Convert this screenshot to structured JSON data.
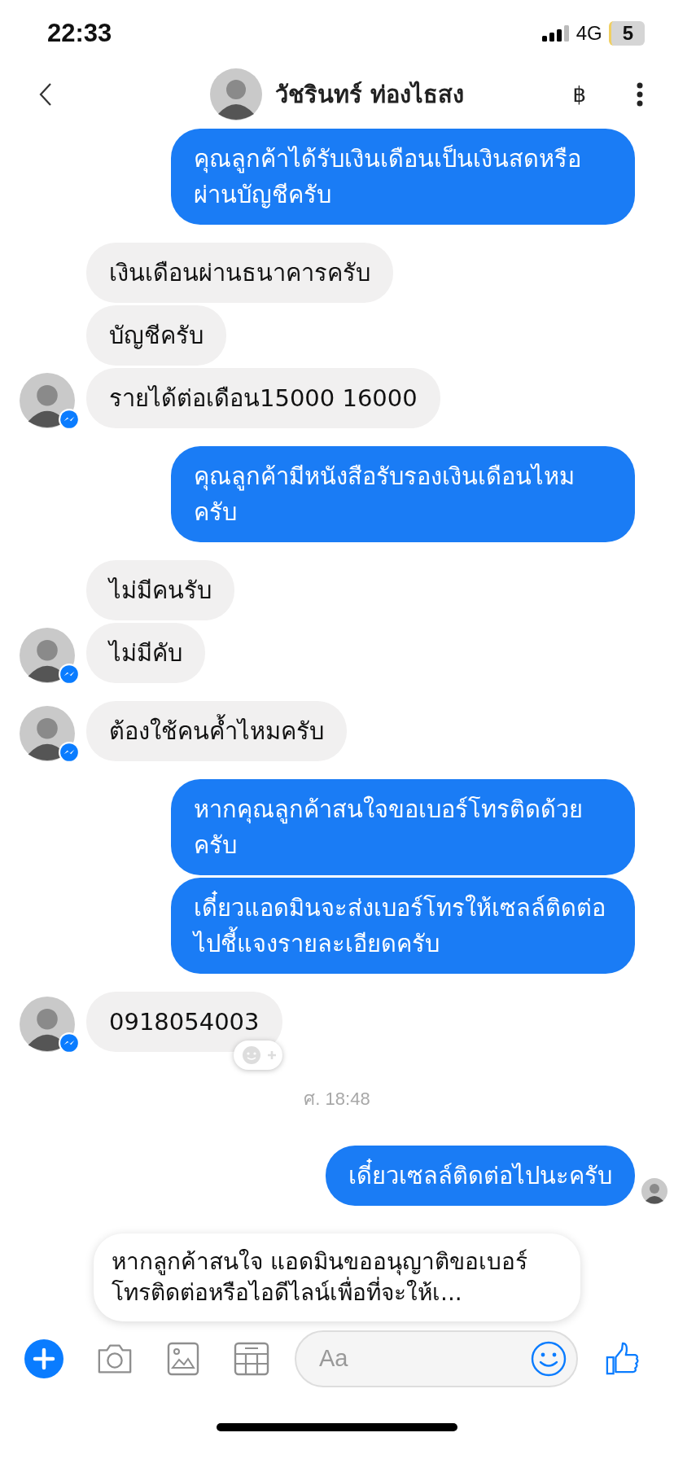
{
  "status_bar": {
    "time": "22:33",
    "network": "4G",
    "battery": "5"
  },
  "header": {
    "title": "วัชรินทร์ ท่องไธสง",
    "currency_symbol": "฿"
  },
  "messages": [
    {
      "kind": "outgoing",
      "text": "คุณลูกค้าได้รับเงินเดือนเป็นเงินสดหรือผ่านบัญชีครับ"
    },
    {
      "kind": "incoming",
      "text": "เงินเดือนผ่านธนาคารครับ",
      "avatar": false
    },
    {
      "kind": "incoming",
      "text": "บัญชีครับ",
      "avatar": false
    },
    {
      "kind": "incoming",
      "text": "รายได้ต่อเดือน15000  16000",
      "avatar": true
    },
    {
      "kind": "outgoing",
      "text": "คุณลูกค้ามีหนังสือรับรองเงินเดือนไหมครับ"
    },
    {
      "kind": "incoming",
      "text": "ไม่มีคนรับ",
      "avatar": false
    },
    {
      "kind": "incoming",
      "text": "ไม่มีคับ",
      "avatar": true
    },
    {
      "kind": "incoming",
      "text": "ต้องใช้คนค้ำไหมครับ",
      "avatar": true
    },
    {
      "kind": "outgoing",
      "text": "หากคุณลูกค้าสนใจขอเบอร์โทรติดด้วยครับ"
    },
    {
      "kind": "outgoing",
      "text": "เดี๋ยวแอดมินจะส่งเบอร์โทรให้เซลล์ติดต่อไปชี้แจงรายละเอียดครับ"
    },
    {
      "kind": "incoming",
      "text": "0918054003",
      "avatar": true,
      "reaction": true
    },
    {
      "kind": "timestamp",
      "text": "ศ. 18:48"
    },
    {
      "kind": "outgoing",
      "text": "เดี๋ยวเซลล์ติดต่อไปนะครับ",
      "seen": true
    }
  ],
  "suggestion": {
    "text": "หากลูกค้าสนใจ แอดมินขออนุญาติขอเบอร์โทรติดต่อหรือไอดีไลน์เพื่อที่จะให้เ..."
  },
  "composer": {
    "placeholder": "Aa"
  }
}
